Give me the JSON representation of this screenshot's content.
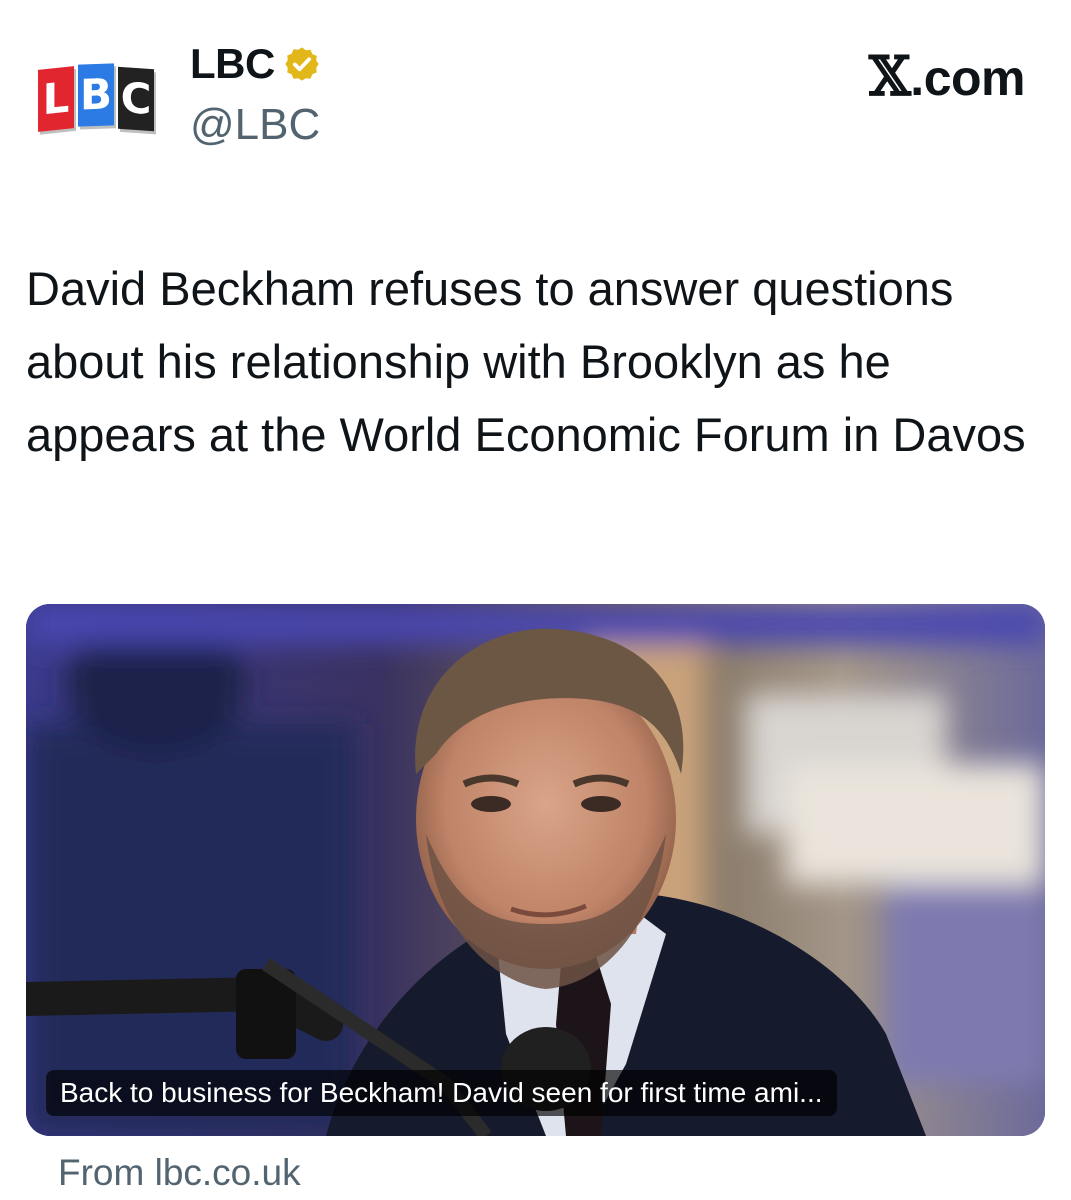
{
  "account": {
    "logo_letters": [
      "L",
      "B",
      "C"
    ],
    "name": "LBC",
    "handle": "@LBC",
    "verified_icon": "verified-gold-badge"
  },
  "source_site": {
    "prefix": "𝕏",
    "label": ".com"
  },
  "tweet": {
    "text": "David Beckham refuses to answer questions about his relationship with Brooklyn as he appears at the World Economic Forum in Davos"
  },
  "card": {
    "image_description": "photo-of-man-at-microphone",
    "caption": "Back to business for Beckham! David seen for first time ami...",
    "from": "From lbc.co.uk"
  },
  "colors": {
    "logo_red": "#e2262f",
    "logo_blue": "#2c7be5",
    "logo_dark": "#222222",
    "handle_gray": "#536471",
    "badge_gold": "#e2b719"
  }
}
